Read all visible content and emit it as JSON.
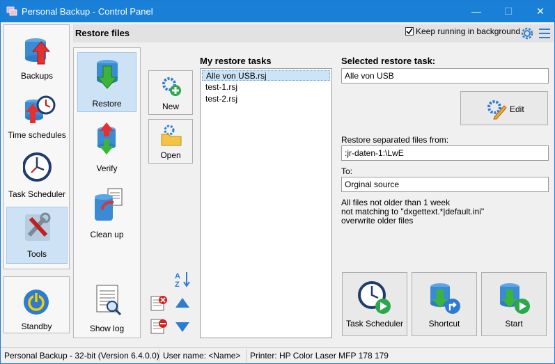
{
  "window": {
    "title": "Personal Backup - Control Panel"
  },
  "sidebar": {
    "items": [
      {
        "label": "Backups"
      },
      {
        "label": "Time schedules"
      },
      {
        "label": "Task Scheduler"
      },
      {
        "label": "Tools"
      }
    ],
    "standby_label": "Standby"
  },
  "header": {
    "title": "Restore files",
    "keep_running_label": "Keep running in background",
    "keep_running_checked": true
  },
  "subsidebar": {
    "items": [
      {
        "label": "Restore"
      },
      {
        "label": "Verify"
      },
      {
        "label": "Clean up"
      },
      {
        "label": "Show log"
      }
    ]
  },
  "toolbar": {
    "new_label": "New",
    "open_label": "Open"
  },
  "tasks": {
    "heading": "My restore tasks",
    "items": [
      "Alle von USB.rsj",
      "test-1.rsj",
      "test-2.rsj"
    ],
    "selected_index": 0
  },
  "selected": {
    "heading": "Selected restore task:",
    "name": "Alle von USB",
    "edit_label": "Edit",
    "restore_from_label": "Restore separated files from:",
    "restore_from": ":jr-daten-1:\\LwE",
    "to_label": "To:",
    "to": "Orginal source",
    "info_lines": [
      "All files not older than 1 week",
      "not matching to \"dxgettext.*|default.ini\"",
      "overwrite older files"
    ]
  },
  "actions": {
    "task_scheduler_label": "Task Scheduler",
    "shortcut_label": "Shortcut",
    "start_label": "Start"
  },
  "statusbar": {
    "version": "Personal Backup - 32-bit (Version 6.4.0.0)",
    "user": "User name: <Name>",
    "printer": "Printer: HP Color Laser MFP 178 179"
  },
  "colors": {
    "titlebar": "#1a7fd6",
    "selected_bg": "#cde2f5",
    "accent_blue": "#2e7bd2"
  }
}
